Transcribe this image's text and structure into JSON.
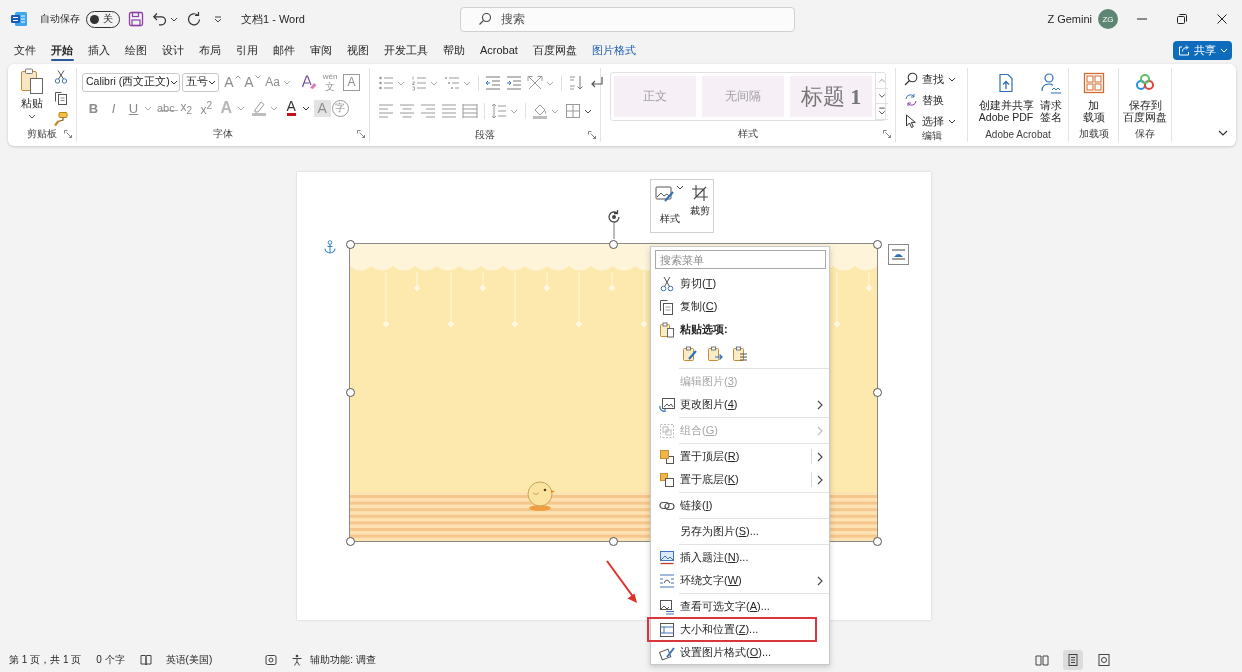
{
  "title_bar": {
    "autosave_label": "自动保存",
    "autosave": {
      "on": false,
      "label": "关"
    },
    "document_title": "文档1 - Word",
    "search": {
      "placeholder": "搜索"
    },
    "user_name": "Z Gemini",
    "avatar_initials": "ZG"
  },
  "tabs": [
    {
      "label": "文件",
      "selected": false,
      "kind": "standard"
    },
    {
      "label": "开始",
      "selected": true,
      "kind": "standard"
    },
    {
      "label": "插入",
      "selected": false,
      "kind": "standard"
    },
    {
      "label": "绘图",
      "selected": false,
      "kind": "standard"
    },
    {
      "label": "设计",
      "selected": false,
      "kind": "standard"
    },
    {
      "label": "布局",
      "selected": false,
      "kind": "standard"
    },
    {
      "label": "引用",
      "selected": false,
      "kind": "standard"
    },
    {
      "label": "邮件",
      "selected": false,
      "kind": "standard"
    },
    {
      "label": "审阅",
      "selected": false,
      "kind": "standard"
    },
    {
      "label": "视图",
      "selected": false,
      "kind": "standard"
    },
    {
      "label": "开发工具",
      "selected": false,
      "kind": "standard"
    },
    {
      "label": "帮助",
      "selected": false,
      "kind": "standard"
    },
    {
      "label": "Acrobat",
      "selected": false,
      "kind": "standard"
    },
    {
      "label": "百度网盘",
      "selected": false,
      "kind": "standard"
    },
    {
      "label": "图片格式",
      "selected": false,
      "kind": "contextual"
    }
  ],
  "share_button": {
    "label": "共享"
  },
  "ribbon": {
    "clipboard": {
      "paste_label": "粘贴",
      "group_label": "剪贴板"
    },
    "font": {
      "font_name": "Calibri (西文正文)",
      "font_size": "五号",
      "row1": [
        {
          "kind": "grow",
          "text": "A"
        },
        {
          "kind": "shrink",
          "text": "A"
        },
        {
          "kind": "case",
          "text": "Aa"
        },
        {
          "kind": "clear"
        },
        {
          "kind": "phonetic",
          "ruby": "wén",
          "text": "文"
        },
        {
          "kind": "border",
          "text": "A"
        }
      ],
      "row2": [
        {
          "kind": "bold",
          "text": "B"
        },
        {
          "kind": "italic",
          "text": "I"
        },
        {
          "kind": "underline",
          "text": "U"
        },
        {
          "kind": "strike",
          "text": "a̶b̶c̶"
        },
        {
          "kind": "sub",
          "text": "x$_{2}$"
        },
        {
          "kind": "sup",
          "text": "x$^{2}$"
        },
        {
          "kind": "effects",
          "text": "A"
        },
        {
          "kind": "highlight"
        },
        {
          "kind": "color",
          "text": "A"
        },
        {
          "kind": "shading",
          "text": "A"
        },
        {
          "kind": "enclosed",
          "text": "字"
        }
      ],
      "group_label": "字体"
    },
    "paragraph": {
      "group_label": "段落"
    },
    "styles": {
      "tiles": [
        {
          "label": "正文",
          "kind": "body"
        },
        {
          "label": "无间隔",
          "kind": "body"
        },
        {
          "label": "标题 **1**",
          "kind": "heading"
        }
      ],
      "group_label": "样式"
    },
    "editing": {
      "items": [
        {
          "label": "查找",
          "kind": "find"
        },
        {
          "label": "替换",
          "kind": "replace"
        },
        {
          "label": "选择",
          "kind": "select"
        }
      ],
      "group_label": "编辑"
    },
    "acrobat": {
      "buttons": [
        {
          "kind": "pdf",
          "lines": [
            "创建并共享",
            "Adobe PDF"
          ]
        },
        {
          "kind": "sign",
          "lines": [
            "请求",
            "签名"
          ]
        }
      ],
      "group_label": "Adobe Acrobat"
    },
    "addins": {
      "lines": [
        "加",
        "载项"
      ],
      "group_label": "加载项"
    },
    "save": {
      "lines": [
        "保存到",
        "百度网盘"
      ],
      "group_label": "保存"
    }
  },
  "mini_toolbar": [
    {
      "kind": "style",
      "label": "样式"
    },
    {
      "kind": "crop",
      "label": "裁剪"
    }
  ],
  "context_menu": {
    "search": {
      "placeholder": "搜索菜单"
    },
    "items": [
      {
        "kind": "command",
        "before": "剪切(",
        "key": "T",
        "after": ")",
        "disabled": false,
        "submenu": false,
        "split": false,
        "highlighted": false
      },
      {
        "kind": "command",
        "before": "复制(",
        "key": "C",
        "after": ")",
        "disabled": false,
        "submenu": false,
        "split": false,
        "highlighted": false
      },
      {
        "kind": "header",
        "text": "粘贴选项:"
      },
      {
        "kind": "paste_options"
      },
      {
        "kind": "separator"
      },
      {
        "kind": "command",
        "before": "编辑图片(",
        "key": "3",
        "after": ")",
        "disabled": true,
        "submenu": false,
        "split": false,
        "highlighted": false
      },
      {
        "kind": "command",
        "before": "更改图片(",
        "key": "4",
        "after": ")",
        "disabled": false,
        "submenu": true,
        "split": false,
        "highlighted": false
      },
      {
        "kind": "separator"
      },
      {
        "kind": "command",
        "before": "组合(",
        "key": "G",
        "after": ")",
        "disabled": true,
        "submenu": true,
        "split": false,
        "highlighted": false
      },
      {
        "kind": "separator"
      },
      {
        "kind": "command",
        "before": "置于顶层(",
        "key": "R",
        "after": ")",
        "disabled": false,
        "submenu": true,
        "split": true,
        "highlighted": false
      },
      {
        "kind": "command",
        "before": "置于底层(",
        "key": "K",
        "after": ")",
        "disabled": false,
        "submenu": true,
        "split": true,
        "highlighted": false
      },
      {
        "kind": "separator"
      },
      {
        "kind": "command",
        "before": "链接(",
        "key": "I",
        "after": ")",
        "disabled": false,
        "submenu": false,
        "split": false,
        "highlighted": false
      },
      {
        "kind": "separator"
      },
      {
        "kind": "command",
        "before": "另存为图片(",
        "key": "S",
        "after": ")...",
        "disabled": false,
        "submenu": false,
        "split": false,
        "highlighted": false
      },
      {
        "kind": "separator"
      },
      {
        "kind": "command",
        "before": "插入题注(",
        "key": "N",
        "after": ")...",
        "disabled": false,
        "submenu": false,
        "split": false,
        "highlighted": false
      },
      {
        "kind": "command",
        "before": "环绕文字(",
        "key": "W",
        "after": ")",
        "disabled": false,
        "submenu": true,
        "split": false,
        "highlighted": false
      },
      {
        "kind": "separator"
      },
      {
        "kind": "command",
        "before": "查看可选文字(",
        "key": "A",
        "after": ")...",
        "disabled": false,
        "submenu": false,
        "split": false,
        "highlighted": false
      },
      {
        "kind": "command",
        "before": "大小和位置(",
        "key": "Z",
        "after": ")...",
        "disabled": false,
        "submenu": false,
        "split": false,
        "highlighted": true
      },
      {
        "kind": "command",
        "before": "设置图片格式(",
        "key": "O",
        "after": ")...",
        "disabled": false,
        "submenu": false,
        "split": false,
        "highlighted": false
      }
    ]
  },
  "status_bar": {
    "page_info": "第 1 页，共 1 页",
    "word_count": "0 个字",
    "language": "英语(美国)",
    "accessibility": "辅助功能: 调查",
    "views": [
      {
        "selected": false
      },
      {
        "selected": true
      },
      {
        "selected": false
      }
    ]
  }
}
